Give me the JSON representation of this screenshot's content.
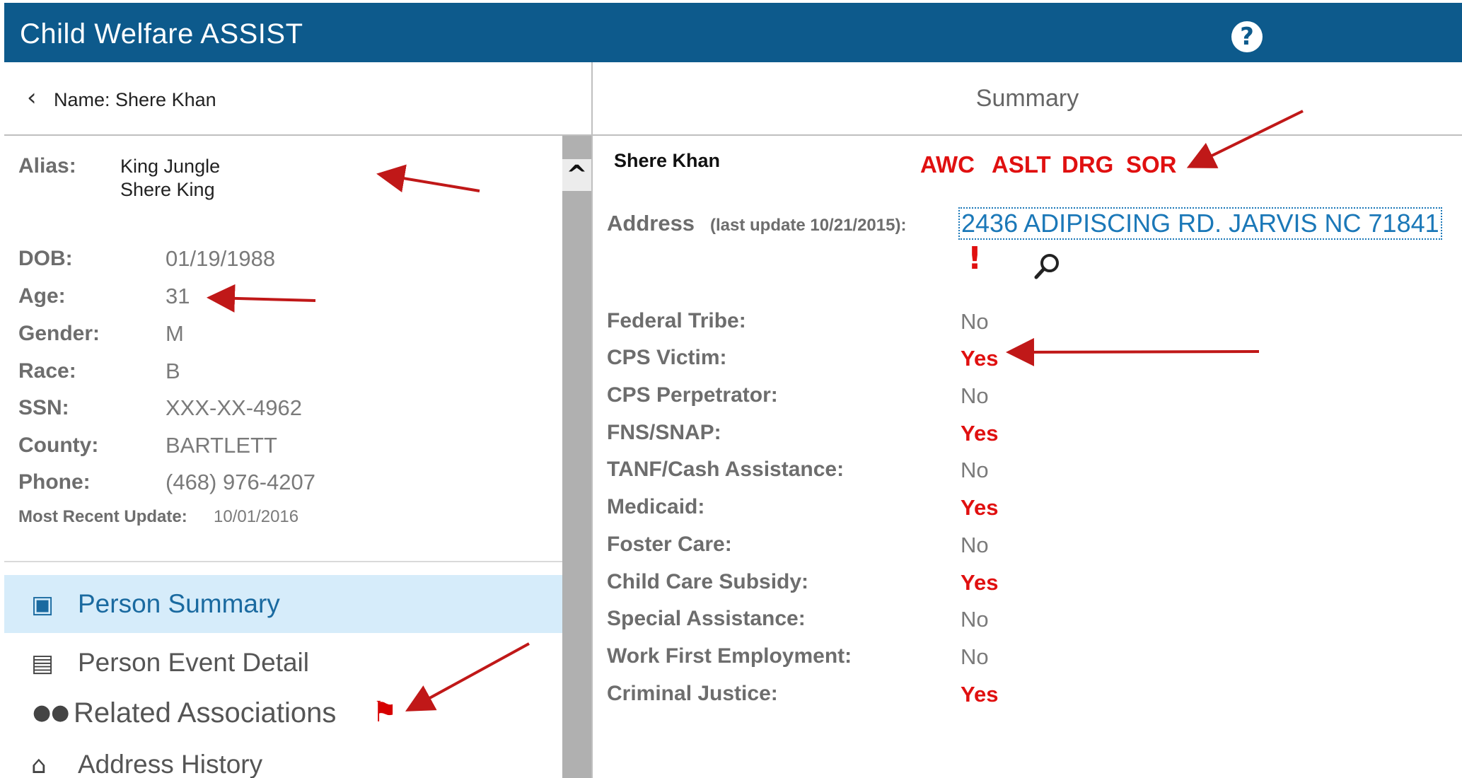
{
  "app": {
    "title": "Child Welfare ASSIST",
    "help_label": "?"
  },
  "left_header": {
    "name_label": "Name: Shere Khan",
    "back_icon": "chevron-left-icon"
  },
  "right_header": {
    "title": "Summary"
  },
  "person": {
    "alias_label": "Alias:",
    "aliases": [
      "King Jungle",
      "Shere King"
    ],
    "fields": [
      {
        "label": "DOB:",
        "value": "01/19/1988"
      },
      {
        "label": "Age:",
        "value": "31"
      },
      {
        "label": "Gender:",
        "value": "M"
      },
      {
        "label": "Race:",
        "value": "B"
      },
      {
        "label": "SSN:",
        "value": "XXX-XX-4962"
      },
      {
        "label": "County:",
        "value": "BARTLETT"
      },
      {
        "label": "Phone:",
        "value": "(468) 976-4207"
      }
    ],
    "recent_update_label": "Most Recent Update:",
    "recent_update_value": "10/01/2016"
  },
  "nav": {
    "items": [
      {
        "label": "Person Summary",
        "icon": "id-card-icon",
        "active": true
      },
      {
        "label": "Person Event Detail",
        "icon": "clipboard-person-icon"
      },
      {
        "label": "Related Associations",
        "icon": "people-group-icon",
        "flag": "flag-icon"
      },
      {
        "label": "Address History",
        "icon": "houses-icon"
      }
    ]
  },
  "summary": {
    "person_name": "Shere Khan",
    "tags": [
      "AWC",
      "ASLT",
      "DRG",
      "SOR"
    ],
    "address_label": "Address",
    "address_note": "(last update 10/21/2015):",
    "address_value": "2436 ADIPISCING RD. JARVIS NC 71841",
    "alert_glyph": "!",
    "rows": [
      {
        "label": "Federal Tribe:",
        "value": "No"
      },
      {
        "label": "CPS Victim:",
        "value": "Yes"
      },
      {
        "label": "CPS Perpetrator:",
        "value": "No"
      },
      {
        "label": "FNS/SNAP:",
        "value": "Yes"
      },
      {
        "label": "TANF/Cash Assistance:",
        "value": "No"
      },
      {
        "label": "Medicaid:",
        "value": "Yes"
      },
      {
        "label": "Foster Care:",
        "value": "No"
      },
      {
        "label": "Child Care Subsidy:",
        "value": "Yes"
      },
      {
        "label": "Special Assistance:",
        "value": "No"
      },
      {
        "label": "Work First Employment:",
        "value": "No"
      },
      {
        "label": "Criminal Justice:",
        "value": "Yes"
      }
    ]
  },
  "colors": {
    "header_bg": "#0d5a8c",
    "accent": "#1a6aa0",
    "alert_red": "#e01010",
    "active_nav_bg": "#d6ecfa"
  }
}
